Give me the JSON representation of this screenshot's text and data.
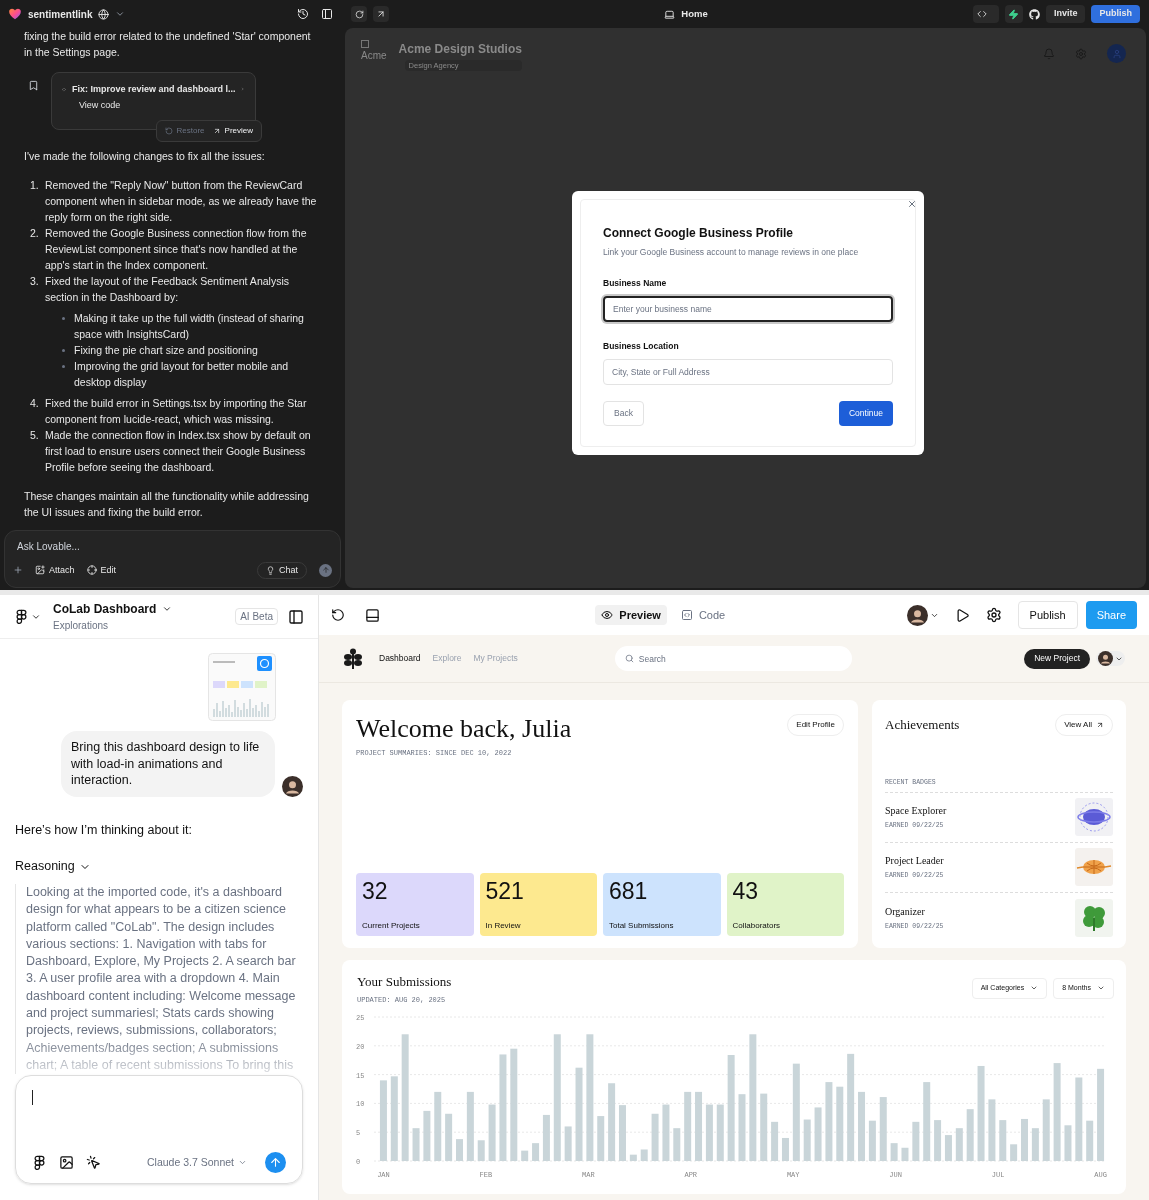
{
  "lovable": {
    "project": {
      "name": "sentimentlink"
    },
    "chat": {
      "intro": "fixing the build error related to the undefined 'Star' component in the Settings page.",
      "commit": {
        "title": "Fix: Improve review and dashboard l...",
        "link": "View code",
        "actions": [
          {
            "label": "Restore",
            "disabled": true
          },
          {
            "label": "Preview",
            "disabled": false
          }
        ]
      },
      "lead": "I've made the following changes to fix all the issues:",
      "changes": [
        {
          "number": "1.",
          "text": "Removed the \"Reply Now\" button from the ReviewCard component when in sidebar mode, as we already have the reply form on the right side."
        },
        {
          "number": "2.",
          "text": "Removed the Google Business connection flow from the ReviewList component since that's now handled at the app's start in the Index component."
        },
        {
          "number": "3.",
          "text": "Fixed the layout of the Feedback Sentiment Analysis section in the Dashboard by:",
          "children": [
            {
              "text": "Making it take up the full width (instead of sharing space with InsightsCard)"
            },
            {
              "text": "Fixing the pie chart size and positioning"
            },
            {
              "text": "Improving the grid layout for better mobile and desktop display"
            }
          ]
        },
        {
          "number": "4.",
          "text": "Fixed the build error in Settings.tsx by importing the Star component from lucide-react, which was missing."
        },
        {
          "number": "5.",
          "text": "Made the connection flow in Index.tsx show by default on first load to ensure users connect their Google Business Profile before seeing the dashboard."
        }
      ],
      "closing": "These changes maintain all the functionality while addressing the UI issues and fixing the build error."
    },
    "composer": {
      "placeholder": "Ask Lovable...",
      "buttons": [
        "Attach",
        "Edit"
      ],
      "mode": "Chat"
    },
    "toolbar": {
      "page": "Home",
      "buttons": [
        "Invite",
        "Publish"
      ]
    },
    "preview": {
      "logo_alt": "Acme",
      "company": "Acme Design Studios",
      "tagline": "Design Agency",
      "dialog": {
        "title": "Connect Google Business Profile",
        "subtitle": "Link your Google Business account to manage reviews in one place",
        "fields": [
          {
            "label": "Business Name",
            "placeholder": "Enter your business name",
            "focused": true
          },
          {
            "label": "Business Location",
            "placeholder": "City, State or Full Address",
            "focused": false
          }
        ],
        "buttons": [
          "Back",
          "Continue"
        ]
      }
    }
  },
  "figma_make": {
    "header": {
      "file": "CoLab Dashboard",
      "subtitle": "Explorations",
      "badge": "AI Beta"
    },
    "chat": {
      "user_message": "Bring this dashboard design to life with load-in animations and interaction.",
      "reply_intro": "Here’s how I’m thinking about it:",
      "reasoning_label": "Reasoning",
      "reasoning": "Looking at the imported code, it's a dashboard design for what appears to be a citizen science platform called \"CoLab\". The design includes various sections: 1. Navigation with tabs for Dashboard, Explore, My Projects 2. A search bar 3. A user profile area with a dropdown 4. Main dashboard content including: Welcome message and project summariesl; Stats cards showing projects, reviews, submissions, collaborators; Achievements/badges section; A submissions chart; A table of recent submissions To bring this"
    },
    "composer": {
      "model": "Claude 3.7 Sonnet"
    },
    "toolbar": {
      "views": [
        {
          "label": "Preview",
          "selected": true
        },
        {
          "label": "Code",
          "selected": false
        }
      ],
      "buttons": [
        "Publish",
        "Share"
      ]
    },
    "dashboard": {
      "nav": [
        {
          "label": "Dashboard",
          "selected": true
        },
        {
          "label": "Explore",
          "selected": false
        },
        {
          "label": "My Projects",
          "selected": false
        }
      ],
      "search_placeholder": "Search",
      "new_project": "New Project",
      "welcome": {
        "title": "Welcome back, Julia",
        "subtitle": "PROJECT SUMMARIES: SINCE DEC 10, 2022",
        "button": "Edit Profile"
      },
      "stats": [
        {
          "value": "32",
          "label": "Current Projects",
          "color": "#dcd8fb"
        },
        {
          "value": "521",
          "label": "In Review",
          "color": "#fde98f"
        },
        {
          "value": "681",
          "label": "Total Submissions",
          "color": "#cde3fd"
        },
        {
          "value": "43",
          "label": "Collaborators",
          "color": "#e0f3c8"
        }
      ],
      "achievements": {
        "title": "Achievements",
        "button": "View All",
        "section": "RECENT BADGES",
        "badges": [
          {
            "name": "Space Explorer",
            "earned": "EARNED 09/22/25",
            "kind": "planet"
          },
          {
            "name": "Project Leader",
            "earned": "EARNED 09/22/25",
            "kind": "globe"
          },
          {
            "name": "Organizer",
            "earned": "EARNED 09/22/25",
            "kind": "clover"
          }
        ]
      },
      "submissions": {
        "title": "Your Submissions",
        "updated": "UPDATED: AUG 20, 2025",
        "filters": [
          "All Categories",
          "8 Months"
        ],
        "month_labels": [
          "JAN",
          "FEB",
          "MAR",
          "APR",
          "MAY",
          "JUN",
          "JUL",
          "AUG"
        ],
        "chart_data": {
          "type": "bar",
          "ylim": [
            0,
            25
          ],
          "yticks": [
            0,
            5,
            10,
            15,
            20,
            25
          ],
          "grid": true,
          "series": [
            {
              "color": "#c9d5d9",
              "values": [
                14,
                14.7,
                22,
                5.7,
                8.7,
                12,
                8.2,
                3.8,
                12,
                3.6,
                9.8,
                18.5,
                19.5,
                1.8,
                3.1,
                8,
                22,
                6,
                16.2,
                22,
                7.8,
                13.5,
                9.7,
                1.1,
                2,
                8.2,
                9.8,
                5.7,
                12,
                12,
                9.8,
                9.8,
                18.4,
                11.6,
                22,
                11.7,
                6.8,
                4,
                16.9,
                7.2,
                9.3,
                13.7,
                12.9,
                18.6,
                12,
                7,
                11.1,
                3.1,
                2.3,
                6.8,
                13.7,
                7.1,
                4.5,
                5.7,
                9,
                16.5,
                10.7,
                7.1,
                2.9,
                7.3,
                5.7,
                10.7,
                17,
                6.2,
                14.5,
                7,
                16
              ]
            }
          ]
        }
      }
    }
  }
}
